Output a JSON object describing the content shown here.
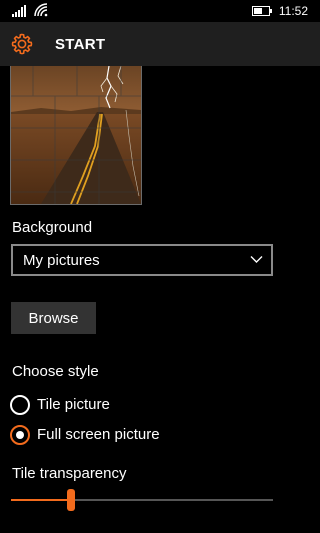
{
  "status_bar": {
    "time": "11:52",
    "icons": [
      "signal-icon",
      "wifi-icon",
      "battery-icon"
    ]
  },
  "header": {
    "icon": "gear-icon",
    "title": "START"
  },
  "preview": {
    "description_icon": "background-preview-image"
  },
  "background": {
    "label": "Background",
    "selected": "My pictures"
  },
  "browse_label": "Browse",
  "style": {
    "label": "Choose style",
    "options": [
      {
        "label": "Tile picture",
        "checked": false
      },
      {
        "label": "Full screen picture",
        "checked": true
      }
    ]
  },
  "tile_transparency": {
    "label": "Tile transparency",
    "value_fraction": 0.23
  },
  "colors": {
    "accent": "#f26b1d",
    "background": "#000000",
    "header": "#1f1f1f",
    "button": "#333333"
  }
}
